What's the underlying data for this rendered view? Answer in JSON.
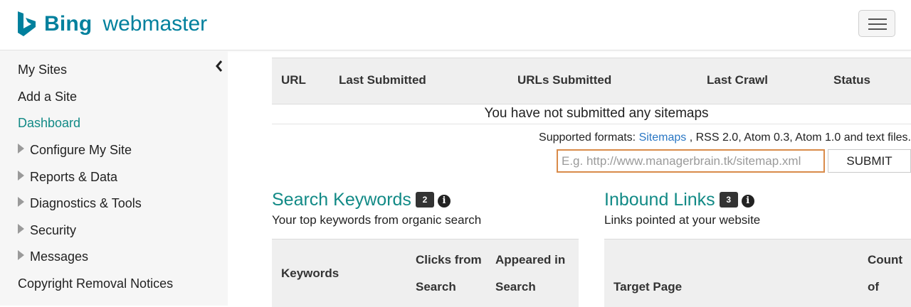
{
  "header": {
    "brand": "Bing",
    "product": "webmaster",
    "logo_icon": "bing-b-logo",
    "menu_icon": "hamburger-icon",
    "brand_color": "#00809d"
  },
  "sidebar": {
    "collapse_icon": "chevron-left-icon",
    "items": [
      {
        "label": "My Sites",
        "expandable": false,
        "active": false
      },
      {
        "label": "Add a Site",
        "expandable": false,
        "active": false
      },
      {
        "label": "Dashboard",
        "expandable": false,
        "active": true
      },
      {
        "label": "Configure My Site",
        "expandable": true,
        "active": false
      },
      {
        "label": "Reports & Data",
        "expandable": true,
        "active": false
      },
      {
        "label": "Diagnostics & Tools",
        "expandable": true,
        "active": false
      },
      {
        "label": "Security",
        "expandable": true,
        "active": false
      },
      {
        "label": "Messages",
        "expandable": true,
        "active": false
      },
      {
        "label": "Copyright Removal Notices",
        "expandable": false,
        "active": false
      }
    ],
    "active_color": "#128a86"
  },
  "sitemaps": {
    "columns": [
      "URL",
      "Last Submitted",
      "URLs Submitted",
      "Last Crawl",
      "Status"
    ],
    "empty_message": "You have not submitted any sitemaps",
    "formats_prefix": "Supported formats:",
    "formats_link": "Sitemaps",
    "formats_suffix": ", RSS 2.0, Atom 0.3, Atom 1.0 and text files.",
    "input_placeholder": "E.g. http://www.managerbrain.tk/sitemap.xml",
    "input_value": "",
    "submit_label": "SUBMIT"
  },
  "search_keywords": {
    "title": "Search Keywords",
    "badge": "2",
    "subtitle": "Your top keywords from organic search",
    "columns": [
      "Keywords",
      "Clicks from Search",
      "Appeared in Search"
    ]
  },
  "inbound_links": {
    "title": "Inbound Links",
    "badge": "3",
    "subtitle": "Links pointed at your website",
    "columns": [
      "Target Page",
      "Count of"
    ]
  }
}
